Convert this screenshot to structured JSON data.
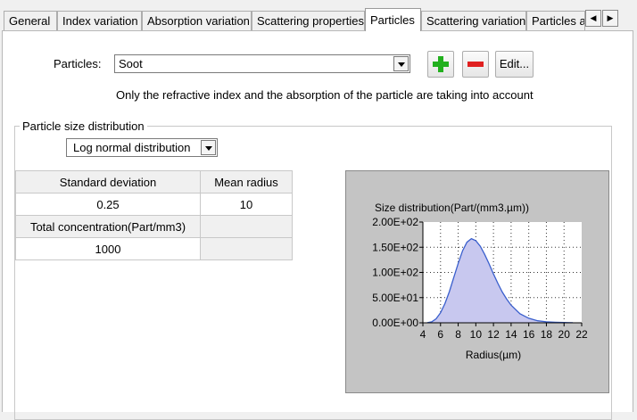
{
  "tabs": [
    {
      "label": "General"
    },
    {
      "label": "Index variation"
    },
    {
      "label": "Absorption variation"
    },
    {
      "label": "Scattering properties"
    },
    {
      "label": "Particles",
      "active": true
    },
    {
      "label": "Scattering variation"
    },
    {
      "label": "Particles a"
    }
  ],
  "particles": {
    "label": "Particles:",
    "selected": "Soot",
    "add_icon": "plus-icon",
    "remove_icon": "minus-icon",
    "edit_label": "Edit...",
    "note": "Only the refractive index and the absorption of the particle are taking into account"
  },
  "distribution": {
    "group_label": "Particle size distribution",
    "type": "Log normal distribution",
    "table": {
      "col1_header": "Standard deviation",
      "col2_header": "Mean radius",
      "std_dev": "0.25",
      "mean_radius": "10",
      "conc_label": "Total concentration(Part/mm3)",
      "conc_value": "1000"
    }
  },
  "colors": {
    "curve": "#3a5fcd",
    "fill": "#c8c8ef",
    "plot_bg": "#ffffff"
  },
  "chart_data": {
    "type": "area",
    "title": "Size distribution(Part/(mm3.µm))",
    "xlabel": "Radius(µm)",
    "ylabel": "",
    "xlim": [
      4,
      22
    ],
    "ylim": [
      0,
      200
    ],
    "x_ticks": [
      "4",
      "6",
      "8",
      "10",
      "12",
      "14",
      "16",
      "18",
      "20",
      "22"
    ],
    "y_ticks": [
      "0.00E+00",
      "5.00E+01",
      "1.00E+02",
      "1.50E+02",
      "2.00E+02"
    ],
    "grid": true,
    "x": [
      4.5,
      5,
      5.5,
      6,
      6.5,
      7,
      7.5,
      8,
      8.5,
      9,
      9.5,
      10,
      10.5,
      11,
      11.5,
      12,
      12.5,
      13,
      13.5,
      14,
      15,
      16,
      17,
      18,
      19,
      20,
      21
    ],
    "y": [
      0.2,
      2,
      8,
      20,
      38,
      62,
      90,
      118,
      143,
      160,
      167,
      163,
      152,
      136,
      117,
      97,
      78,
      61,
      47,
      35,
      18,
      9,
      4,
      2,
      1,
      0.5,
      0.2
    ]
  }
}
